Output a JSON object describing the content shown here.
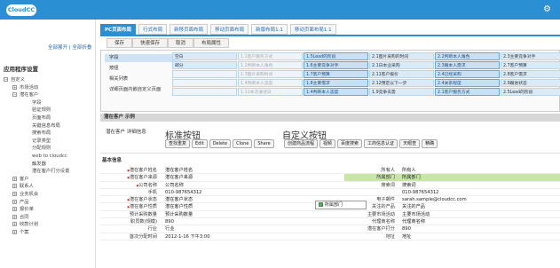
{
  "app": {
    "logo": "CloudCC",
    "gear_icon": "gear-icon"
  },
  "left": {
    "expand_all": "全部展开",
    "sep": "|",
    "collapse_all": "全部折叠",
    "section_title": "应用程序设置",
    "tree": [
      {
        "level": 1,
        "box": "−",
        "label": "自定义"
      },
      {
        "level": 2,
        "box": "+",
        "label": "市场活动"
      },
      {
        "level": 2,
        "box": "−",
        "label": "潜在客户"
      },
      {
        "level": 3,
        "label": "字段"
      },
      {
        "level": 3,
        "label": "验证规则"
      },
      {
        "level": 3,
        "label": "页面布局"
      },
      {
        "level": 3,
        "label": "关键信息布局"
      },
      {
        "level": 3,
        "label": "搜索布局"
      },
      {
        "level": 3,
        "label": "记录类型"
      },
      {
        "level": 3,
        "label": "分配规则"
      },
      {
        "level": 3,
        "label": "web to cloudcc"
      },
      {
        "level": 3,
        "label": "触发器"
      },
      {
        "level": 3,
        "label": "潜在客户打分设置"
      },
      {
        "level": 2,
        "box": "+",
        "label": "客户"
      },
      {
        "level": 2,
        "box": "+",
        "label": "联系人"
      },
      {
        "level": 2,
        "box": "+",
        "label": "业务机会"
      },
      {
        "level": 2,
        "box": "+",
        "label": "产品"
      },
      {
        "level": 2,
        "box": "+",
        "label": "报价单"
      },
      {
        "level": 2,
        "box": "+",
        "label": "合同"
      },
      {
        "level": 2,
        "box": "+",
        "label": "收款计划"
      },
      {
        "level": 2,
        "box": "+",
        "label": "个案"
      }
    ]
  },
  "tabs": [
    "PC页面布局",
    "行式布局",
    "新移页面布局",
    "移动页面布局",
    "新版布局1.1",
    "移动页面布局1.1"
  ],
  "actions": [
    "保存",
    "快速保存",
    "取消",
    "布局属性"
  ],
  "palette": {
    "left_items": [
      "字段",
      "按钮",
      "相关列表",
      "详细页面内嵌自定义页面"
    ],
    "grid": [
      [
        "空白",
        "1.1客户服务方式",
        "1.5Lead的阶段",
        "2.1图片采购的时间",
        "2.2判断本人角色",
        "2.3主要竞争对手"
      ],
      [
        "邮分",
        "1.2判断本人角色",
        "1.6主要竞争对手",
        "2.1日本业采购",
        "2.3跟本人需求",
        "2.7客户预算"
      ],
      [
        "",
        "1.3图片采购时间",
        "1.7客户预算",
        "2.11客户报价",
        "2.4已经采购",
        "2.8客户需求"
      ],
      [
        "",
        "1.4判断本人态度",
        "1.8主要需求",
        "2.12预定以下一步",
        "2.4关系程度",
        "2.9跟进状态"
      ],
      [
        "",
        "1.11本次通话日",
        "1.4判断本人态度",
        "1.9竞争去势",
        "2.1客户服务方式",
        "2.5Lead的阶段"
      ]
    ]
  },
  "layout": {
    "section_title": "潜在客户 示例",
    "detail_header": "潜在客户 详细信息",
    "std_label": "标准按钮",
    "cus_label": "自定义按钮",
    "std_buttons": [
      "查找重复",
      "Edit",
      "Delete",
      "Clone",
      "Share"
    ],
    "cus_buttons": [
      "创建商品流程",
      "视频",
      "百度搜索",
      "工商信息认证",
      "天眼查",
      "精确"
    ],
    "info_header": "基本信息",
    "popup_label": "所属部门",
    "rows": [
      {
        "l": "潜在客户姓名",
        "lr": true,
        "lv": "潜在客户姓名",
        "r": "所有人",
        "rv": "所有人"
      },
      {
        "l": "潜在客户来源",
        "lr": true,
        "lv": "潜在客户来源",
        "r": "所属部门",
        "rv": "所属部门",
        "hl": true
      },
      {
        "l": "公司名称",
        "lr": true,
        "lv": "公司名称",
        "r": "搜索词",
        "rv": "搜索词"
      },
      {
        "l": "手机",
        "lr": false,
        "lv": "010-987654312",
        "r": "",
        "rv": "010-987654312"
      },
      {
        "l": "潜在客户状态",
        "lr": true,
        "lv": "潜在客户状态",
        "r": "电子邮件",
        "rv": "sarah.sample@cloudcc.com"
      },
      {
        "l": "潜在客户性质",
        "lr": true,
        "lv": "潜在客户性质",
        "r": "关注的产品",
        "rv": "关注的产品"
      },
      {
        "l": "预计采购数量",
        "lr": false,
        "lv": "预计采购数量",
        "r": "主要市场活动",
        "rv": "主要市场活动"
      },
      {
        "l": "职员数(规模)",
        "lr": false,
        "lv": "890",
        "r": "代理商名称",
        "rv": "代理商名称"
      },
      {
        "l": "行业",
        "lr": false,
        "lv": "行业",
        "r": "潜在客户打分",
        "rv": "890"
      },
      {
        "l": "首次分配时间",
        "lr": false,
        "lv": "2012-1-16 下午3:00",
        "r": "地址",
        "rv": "地址"
      }
    ]
  }
}
